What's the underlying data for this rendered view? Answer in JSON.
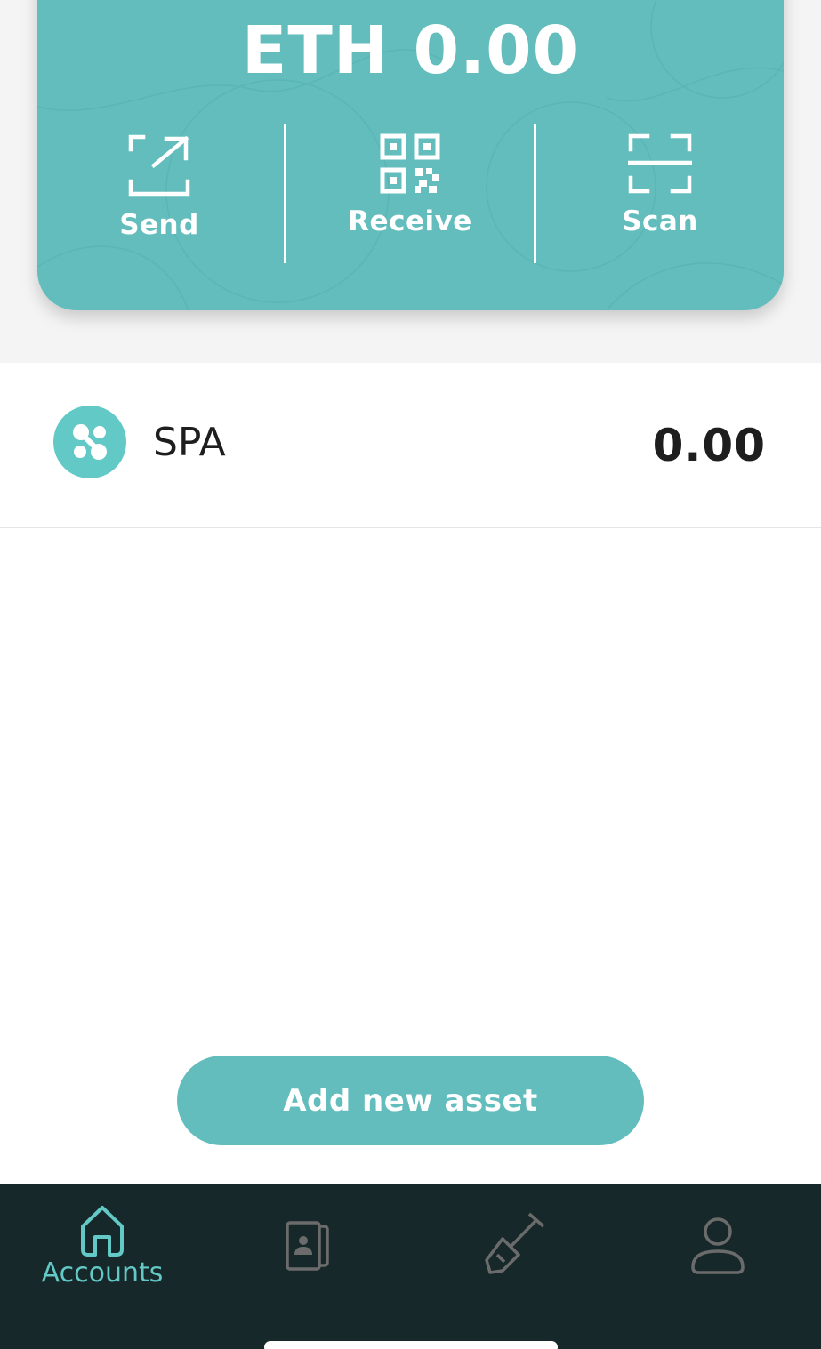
{
  "balance_card": {
    "balance": "ETH 0.00",
    "actions": [
      {
        "label": "Send",
        "icon": "send-icon"
      },
      {
        "label": "Receive",
        "icon": "qr-code-icon"
      },
      {
        "label": "Scan",
        "icon": "scan-icon"
      }
    ]
  },
  "assets": [
    {
      "symbol": "SPA",
      "balance": "0.00",
      "logo_color": "#63c9c6"
    }
  ],
  "add_asset_button": "Add new asset",
  "bottom_nav": {
    "items": [
      {
        "label": "Accounts",
        "icon": "home-icon",
        "active": true
      },
      {
        "label": "",
        "icon": "contacts-icon",
        "active": false
      },
      {
        "label": "",
        "icon": "shovel-icon",
        "active": false
      },
      {
        "label": "",
        "icon": "profile-icon",
        "active": false
      }
    ]
  },
  "colors": {
    "accent": "#63bdbd",
    "nav_background": "#17282a",
    "active_nav": "#63c9c6",
    "inactive_nav": "#6b6b6b"
  }
}
